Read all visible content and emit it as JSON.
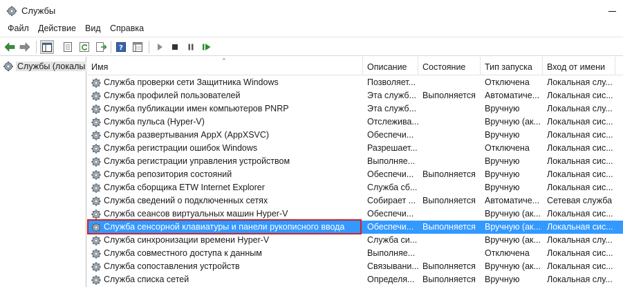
{
  "window": {
    "title": "Службы",
    "icon": "services-gear-icon"
  },
  "menu": [
    "Файл",
    "Действие",
    "Вид",
    "Справка"
  ],
  "toolbar": {
    "buttons": [
      "back-arrow-icon",
      "forward-arrow-icon",
      "show-console-tree-icon",
      "properties-icon",
      "refresh-icon",
      "export-list-icon",
      "help-icon",
      "extended-view-icon",
      "start-service-icon",
      "stop-service-icon",
      "pause-service-icon",
      "restart-service-icon"
    ]
  },
  "tree": {
    "root_label": "Службы (локалы"
  },
  "columns": {
    "name": "Имя",
    "desc": "Описание",
    "state": "Состояние",
    "start": "Тип запуска",
    "logon": "Вход от имени"
  },
  "services": [
    {
      "name": "Служба проверки сети Защитника Windows",
      "desc": "Позволяет...",
      "state": "",
      "start": "Отключена",
      "logon": "Локальная слу..."
    },
    {
      "name": "Служба профилей пользователей",
      "desc": "Эта служб...",
      "state": "Выполняется",
      "start": "Автоматиче...",
      "logon": "Локальная сис..."
    },
    {
      "name": "Служба публикации имен компьютеров PNRP",
      "desc": "Эта служб...",
      "state": "",
      "start": "Вручную",
      "logon": "Локальная слу..."
    },
    {
      "name": "Служба пульса (Hyper-V)",
      "desc": "Отслежива...",
      "state": "",
      "start": "Вручную (ак...",
      "logon": "Локальная сис..."
    },
    {
      "name": "Служба развертывания AppX (AppXSVC)",
      "desc": "Обеспечи...",
      "state": "",
      "start": "Вручную",
      "logon": "Локальная сис..."
    },
    {
      "name": "Служба регистрации ошибок Windows",
      "desc": "Разрешает...",
      "state": "",
      "start": "Отключена",
      "logon": "Локальная сис..."
    },
    {
      "name": "Служба регистрации управления устройством",
      "desc": "Выполняе...",
      "state": "",
      "start": "Вручную",
      "logon": "Локальная сис..."
    },
    {
      "name": "Служба репозитория состояний",
      "desc": "Обеспечи...",
      "state": "Выполняется",
      "start": "Вручную",
      "logon": "Локальная сис..."
    },
    {
      "name": "Служба сборщика ETW Internet Explorer",
      "desc": "Служба сб...",
      "state": "",
      "start": "Вручную",
      "logon": "Локальная сис..."
    },
    {
      "name": "Служба сведений о подключенных сетях",
      "desc": "Собирает ...",
      "state": "Выполняется",
      "start": "Автоматиче...",
      "logon": "Сетевая служба"
    },
    {
      "name": "Служба сеансов виртуальных машин Hyper-V",
      "desc": "Обеспечи...",
      "state": "",
      "start": "Вручную (ак...",
      "logon": "Локальная сис..."
    },
    {
      "name": "Служба сенсорной клавиатуры и панели рукописного ввода",
      "desc": "Обеспечи...",
      "state": "Выполняется",
      "start": "Вручную (ак...",
      "logon": "Локальная сис...",
      "selected": true
    },
    {
      "name": "Служба синхронизации времени Hyper-V",
      "desc": "Служба си...",
      "state": "",
      "start": "Вручную (ак...",
      "logon": "Локальная слу..."
    },
    {
      "name": "Служба совместного доступа к данным",
      "desc": "Выполняе...",
      "state": "",
      "start": "Отключена",
      "logon": "Локальная сис..."
    },
    {
      "name": "Служба сопоставления устройств",
      "desc": "Связывани...",
      "state": "Выполняется",
      "start": "Вручную (ак...",
      "logon": "Локальная сис..."
    },
    {
      "name": "Служба списка сетей",
      "desc": "Определя...",
      "state": "Выполняется",
      "start": "Вручную",
      "logon": "Локальная слу..."
    }
  ],
  "colors": {
    "selection": "#3399ff",
    "highlight_border": "#d0202a"
  }
}
